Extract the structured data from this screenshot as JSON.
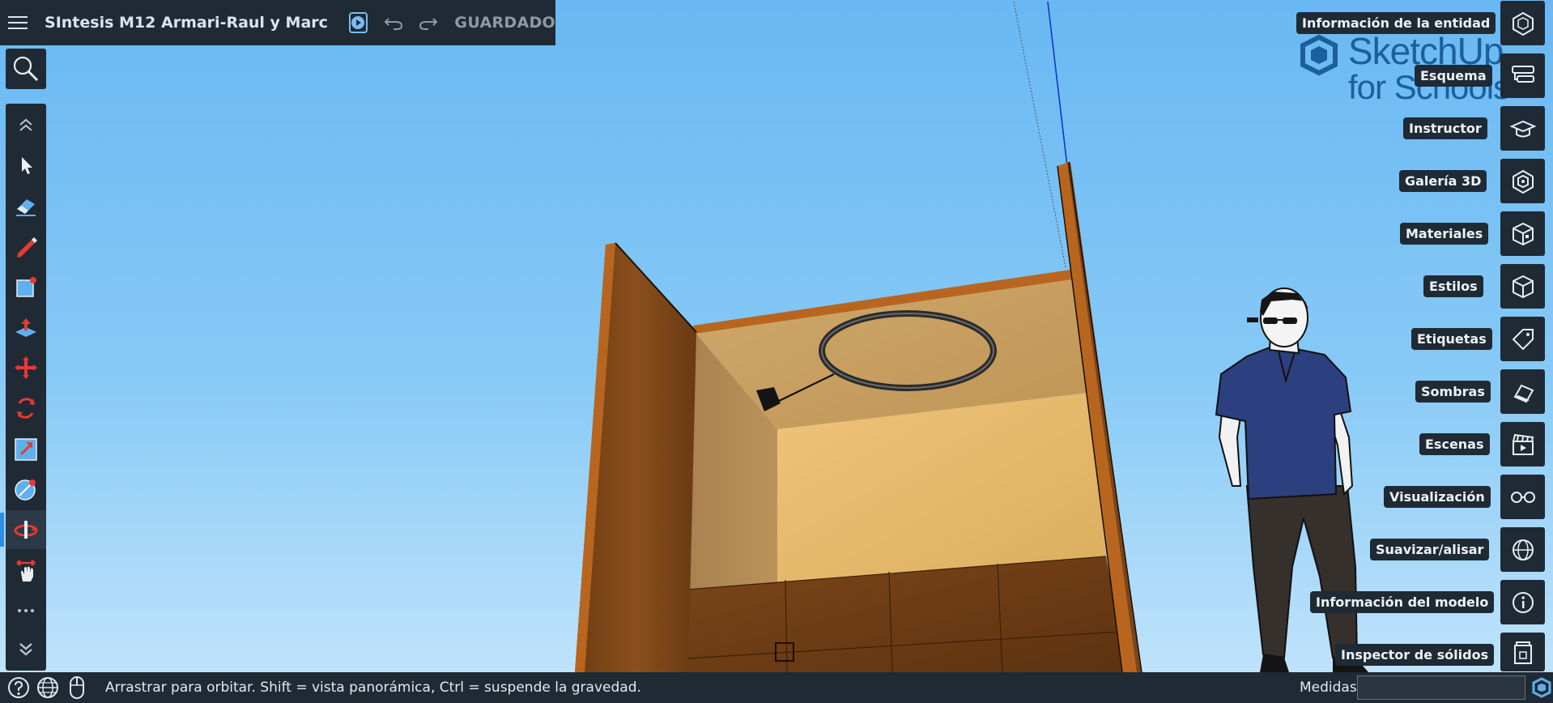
{
  "app": {
    "document_title": "SIntesis M12 Armari-Raul y Marc",
    "save_status": "GUARDADO"
  },
  "logo": {
    "brand": "SketchUp",
    "subtitle": "for Schools"
  },
  "toolbar": {
    "tools": [
      {
        "name": "collapse-up",
        "icon": "chevrons-up-icon"
      },
      {
        "name": "select",
        "icon": "arrow-cursor-icon"
      },
      {
        "name": "eraser",
        "icon": "eraser-icon"
      },
      {
        "name": "line",
        "icon": "pencil-icon"
      },
      {
        "name": "rectangle",
        "icon": "rectangle-icon"
      },
      {
        "name": "push-pull",
        "icon": "push-pull-icon"
      },
      {
        "name": "move",
        "icon": "move-icon"
      },
      {
        "name": "rotate",
        "icon": "rotate-icon"
      },
      {
        "name": "scale",
        "icon": "scale-icon"
      },
      {
        "name": "tape-measure",
        "icon": "tape-measure-icon"
      },
      {
        "name": "orbit",
        "icon": "orbit-icon",
        "active": true
      },
      {
        "name": "pan",
        "icon": "pan-icon"
      },
      {
        "name": "more",
        "icon": "ellipsis-icon"
      },
      {
        "name": "collapse-down",
        "icon": "chevrons-down-icon"
      }
    ]
  },
  "right_panel": {
    "items": [
      {
        "label": "Información de la entidad",
        "icon": "entity-info-icon"
      },
      {
        "label": "Esquema",
        "icon": "outliner-icon"
      },
      {
        "label": "Instructor",
        "icon": "instructor-cap-icon"
      },
      {
        "label": "Galería 3D",
        "icon": "3d-warehouse-icon"
      },
      {
        "label": "Materiales",
        "icon": "materials-cube-icon"
      },
      {
        "label": "Estilos",
        "icon": "styles-icon"
      },
      {
        "label": "Etiquetas",
        "icon": "tag-icon"
      },
      {
        "label": "Sombras",
        "icon": "shadows-icon"
      },
      {
        "label": "Escenas",
        "icon": "scenes-clapper-icon"
      },
      {
        "label": "Visualización",
        "icon": "glasses-icon"
      },
      {
        "label": "Suavizar/alisar",
        "icon": "soften-sphere-icon"
      },
      {
        "label": "Información del modelo",
        "icon": "info-icon"
      },
      {
        "label": "Inspector de sólidos",
        "icon": "solid-inspector-icon"
      }
    ]
  },
  "statusbar": {
    "message": "Arrastrar para orbitar. Shift = vista panorámica, Ctrl = suspende la gravedad.",
    "measures_label": "Medidas",
    "measures_value": ""
  },
  "colors": {
    "panel": "#1f2a35",
    "accent": "#2d8ee8",
    "tool_red": "#e53935",
    "tool_blue": "#5fb0ef",
    "wood_dark": "#7a4518",
    "wood_edge": "#b8661f",
    "chipboard": "#e2b567",
    "sky_top": "#69b8f3",
    "sky_bottom": "#bfe3fb"
  }
}
